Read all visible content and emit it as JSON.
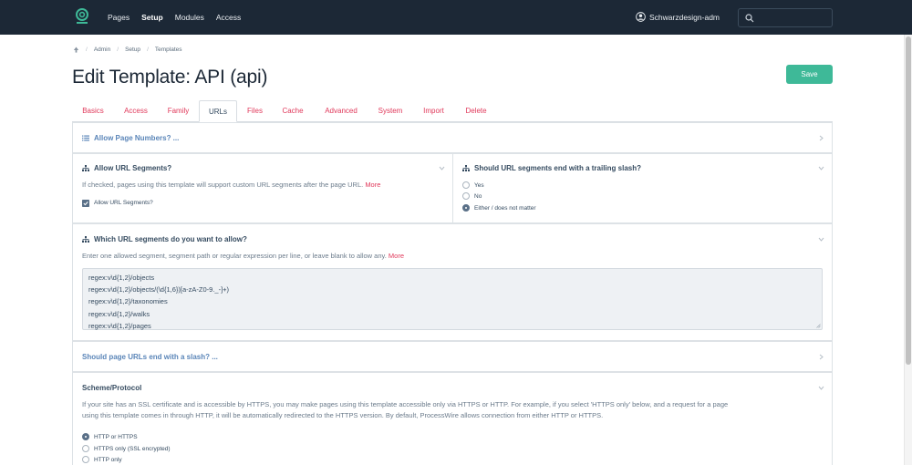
{
  "topbar": {
    "nav": [
      "Pages",
      "Setup",
      "Modules",
      "Access"
    ],
    "active_nav": "Setup",
    "user_name": "Schwarzdesign-adm",
    "search_placeholder": ""
  },
  "breadcrumb": [
    "Admin",
    "Setup",
    "Templates"
  ],
  "page_title": "Edit Template: API (api)",
  "save_label": "Save",
  "tabs": [
    "Basics",
    "Access",
    "Family",
    "URLs",
    "Files",
    "Cache",
    "Advanced",
    "System",
    "Import",
    "Delete"
  ],
  "active_tab": "URLs",
  "fields": {
    "page_numbers": {
      "label": "Allow Page Numbers? ..."
    },
    "url_segments": {
      "label": "Allow URL Segments?",
      "description": "If checked, pages using this template will support custom URL segments after the page URL.",
      "more": "More",
      "checkbox_label": "Allow URL Segments?",
      "checked": true
    },
    "trailing_slash": {
      "label": "Should URL segments end with a trailing slash?",
      "options": [
        "Yes",
        "No",
        "Either / does not matter"
      ],
      "selected": "Either / does not matter"
    },
    "allowed_segments": {
      "label": "Which URL segments do you want to allow?",
      "description": "Enter one allowed segment, segment path or regular expression per line, or leave blank to allow any.",
      "more": "More",
      "lines": [
        "regex:v\\d{1,2}/objects",
        "regex:v\\d{1,2}/objects/(\\d{1,6})[a-zA-Z0-9._-]+)",
        "regex:v\\d{1,2}/taxonomies",
        "regex:v\\d{1,2}/walks",
        "regex:v\\d{1,2}/pages"
      ]
    },
    "page_slash": {
      "label": "Should page URLs end with a slash? ..."
    },
    "scheme": {
      "label": "Scheme/Protocol",
      "description_1": "If your site has an SSL certificate and is accessible by HTTPS, you may make pages using this template accessible only via HTTPS or HTTP. For example, if you select 'HTTPS only' below, and a request for a page",
      "description_2": "using this template comes in through HTTP, it will be automatically redirected to the HTTPS version. By default, ProcessWire allows connection from either HTTP or HTTPS.",
      "options": [
        "HTTP or HTTPS",
        "HTTPS only (SSL encrypted)",
        "HTTP only"
      ],
      "selected": "HTTP or HTTPS"
    }
  },
  "colors": {
    "topbar": "#1c2836",
    "accent_link": "#e0385a",
    "save_button": "#3eb998",
    "collapsed_header": "#5a85b8"
  }
}
